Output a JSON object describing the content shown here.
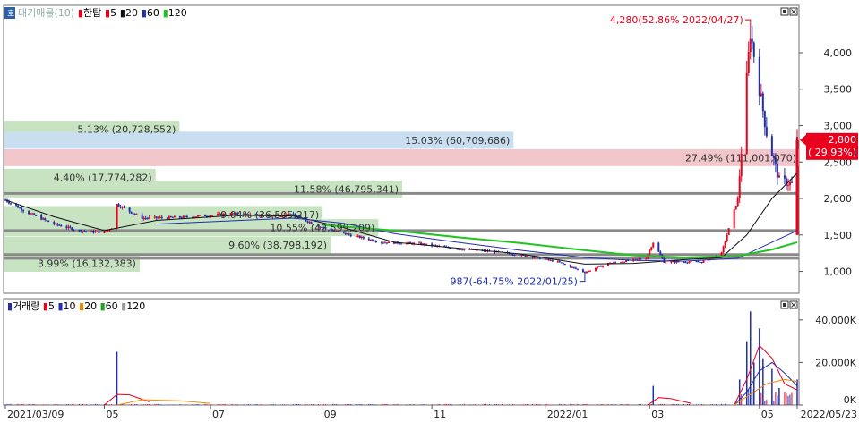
{
  "legend_price": {
    "items": [
      {
        "label": "대기매물(10)",
        "color": "#9bb9b0"
      },
      {
        "label": "한탑",
        "color": "#e8001c"
      },
      {
        "label": "5",
        "color": "#e8001c"
      },
      {
        "label": "20",
        "color": "#111111"
      },
      {
        "label": "60",
        "color": "#1f2fb0"
      },
      {
        "label": "120",
        "color": "#22c422"
      }
    ]
  },
  "legend_volume": {
    "items": [
      {
        "label": "거래량",
        "color": "#1f2fb0"
      },
      {
        "label": "5",
        "color": "#e8001c"
      },
      {
        "label": "10",
        "color": "#1f2fb0"
      },
      {
        "label": "20",
        "color": "#f08c00"
      },
      {
        "label": "60",
        "color": "#22a022"
      },
      {
        "label": "120",
        "color": "#999999"
      }
    ]
  },
  "controls": {
    "corner_label": "호"
  },
  "chart_data": [
    {
      "type": "candlestick",
      "ylim": [
        700,
        4650
      ],
      "yticks": [
        1000,
        1500,
        2000,
        2500,
        3000,
        3500,
        4000
      ],
      "ytick_labels": [
        "1,000",
        "1,500",
        "2,000",
        "2,500",
        "3,000",
        "3,500",
        "4,000"
      ],
      "x_labels": [
        {
          "date": "2021-03-09",
          "label": "2021/03/09"
        },
        {
          "date": "2021-05-03",
          "label": "05"
        },
        {
          "date": "2021-07-01",
          "label": "07"
        },
        {
          "date": "2021-09-01",
          "label": "09"
        },
        {
          "date": "2021-11-01",
          "label": "11"
        },
        {
          "date": "2022-01-03",
          "label": "2022/01"
        },
        {
          "date": "2022-03-02",
          "label": "03"
        },
        {
          "date": "2022-05-02",
          "label": "05"
        },
        {
          "date": "2022-05-23",
          "label": "2022/05/23"
        }
      ],
      "price_path": [
        [
          "2021-03-09",
          1980
        ],
        [
          "2021-03-22",
          1800
        ],
        [
          "2021-04-05",
          1650
        ],
        [
          "2021-04-19",
          1560
        ],
        [
          "2021-05-03",
          1530
        ],
        [
          "2021-05-07",
          1600
        ],
        [
          "2021-05-10",
          1920
        ],
        [
          "2021-05-24",
          1730
        ],
        [
          "2021-06-14",
          1740
        ],
        [
          "2021-07-12",
          1790
        ],
        [
          "2021-08-02",
          1760
        ],
        [
          "2021-08-16",
          1780
        ],
        [
          "2021-08-30",
          1620
        ],
        [
          "2021-09-13",
          1520
        ],
        [
          "2021-10-04",
          1400
        ],
        [
          "2021-10-25",
          1380
        ],
        [
          "2021-11-15",
          1310
        ],
        [
          "2021-12-06",
          1270
        ],
        [
          "2021-12-27",
          1200
        ],
        [
          "2022-01-10",
          1130
        ],
        [
          "2022-01-25",
          987
        ],
        [
          "2022-02-07",
          1110
        ],
        [
          "2022-02-28",
          1180
        ],
        [
          "2022-03-04",
          1400
        ],
        [
          "2022-03-10",
          1130
        ],
        [
          "2022-03-31",
          1130
        ],
        [
          "2022-04-11",
          1250
        ],
        [
          "2022-04-20",
          2000
        ],
        [
          "2022-04-27",
          4280
        ],
        [
          "2022-05-06",
          2900
        ],
        [
          "2022-05-13",
          2250
        ],
        [
          "2022-05-20",
          2200
        ],
        [
          "2022-05-23",
          2800
        ]
      ],
      "series": [
        {
          "name": "20",
          "color": "#111111",
          "points": [
            [
              "2021-03-09",
              1980
            ],
            [
              "2021-04-05",
              1750
            ],
            [
              "2021-05-03",
              1560
            ],
            [
              "2021-06-01",
              1700
            ],
            [
              "2021-07-15",
              1770
            ],
            [
              "2021-08-16",
              1760
            ],
            [
              "2021-09-13",
              1600
            ],
            [
              "2021-10-11",
              1400
            ],
            [
              "2021-11-15",
              1320
            ],
            [
              "2021-12-20",
              1240
            ],
            [
              "2022-01-25",
              1100
            ],
            [
              "2022-02-21",
              1110
            ],
            [
              "2022-03-21",
              1160
            ],
            [
              "2022-04-11",
              1190
            ],
            [
              "2022-04-25",
              1500
            ],
            [
              "2022-05-09",
              2000
            ],
            [
              "2022-05-23",
              2350
            ]
          ]
        },
        {
          "name": "60",
          "color": "#1f2fb0",
          "points": [
            [
              "2021-06-01",
              1650
            ],
            [
              "2021-08-16",
              1730
            ],
            [
              "2021-09-13",
              1660
            ],
            [
              "2021-10-11",
              1520
            ],
            [
              "2021-11-15",
              1400
            ],
            [
              "2021-12-20",
              1290
            ],
            [
              "2022-01-25",
              1190
            ],
            [
              "2022-02-21",
              1150
            ],
            [
              "2022-03-21",
              1140
            ],
            [
              "2022-04-20",
              1180
            ],
            [
              "2022-05-09",
              1400
            ],
            [
              "2022-05-23",
              1560
            ]
          ]
        },
        {
          "name": "120",
          "color": "#22c422",
          "points": [
            [
              "2021-09-01",
              1640
            ],
            [
              "2021-10-11",
              1560
            ],
            [
              "2021-11-15",
              1470
            ],
            [
              "2021-12-20",
              1390
            ],
            [
              "2022-01-25",
              1290
            ],
            [
              "2022-02-21",
              1220
            ],
            [
              "2022-03-21",
              1190
            ],
            [
              "2022-04-20",
              1210
            ],
            [
              "2022-05-09",
              1300
            ],
            [
              "2022-05-23",
              1400
            ]
          ]
        }
      ],
      "supply_zones": [
        {
          "label": "5.13% (20,728,552)",
          "price": 2950,
          "fraction": 0.22,
          "color": "#c7e3c2"
        },
        {
          "label": "15.03% (60,709,686)",
          "price": 2800,
          "fraction": 0.64,
          "color": "#c9dff0"
        },
        {
          "label": "27.49% (111,001,070)",
          "price": 2560,
          "fraction": 1.0,
          "color": "#f2c7cb"
        },
        {
          "label": "4.40% (17,774,282)",
          "price": 2290,
          "fraction": 0.19,
          "color": "#c7e3c2"
        },
        {
          "label": "11.58% (46,795,341)",
          "price": 2130,
          "fraction": 0.5,
          "color": "#c7e3c2"
        },
        {
          "label": "9.04% (36,505,217)",
          "price": 1780,
          "fraction": 0.4,
          "color": "#c7e3c2"
        },
        {
          "label": "10.55% (42,599,209)",
          "price": 1600,
          "fraction": 0.47,
          "color": "#c7e3c2"
        },
        {
          "label": "9.60% (38,798,192)",
          "price": 1360,
          "fraction": 0.41,
          "color": "#c7e3c2"
        },
        {
          "label": "3.99% (16,132,383)",
          "price": 1110,
          "fraction": 0.17,
          "color": "#c7e3c2"
        }
      ],
      "horizontal_lines": [
        2070,
        1560,
        1230,
        1180
      ],
      "annotations": [
        {
          "text": "4,280(52.86% 2022/04/27)",
          "date": "2022-04-27",
          "price": 4280,
          "color": "#e8001c"
        },
        {
          "text": "987(-64.75% 2022/01/25)",
          "date": "2022-01-25",
          "price": 987,
          "color": "#1f2fb0"
        }
      ],
      "current_price": {
        "value": 2800,
        "label": "2,800",
        "change": "( 29.93%)",
        "color": "#e8001c"
      }
    },
    {
      "type": "bar",
      "ylim": [
        0,
        50000
      ],
      "yticks": [
        0,
        20000,
        40000
      ],
      "ytick_labels": [
        "0K",
        "20,000K",
        "40,000K"
      ],
      "spikes": [
        [
          "2021-05-10",
          25000
        ],
        [
          "2022-03-04",
          9000
        ],
        [
          "2022-04-21",
          12000
        ],
        [
          "2022-04-25",
          30000
        ],
        [
          "2022-04-27",
          44000
        ],
        [
          "2022-04-29",
          20000
        ],
        [
          "2022-05-02",
          36000
        ],
        [
          "2022-05-04",
          22000
        ],
        [
          "2022-05-09",
          17000
        ],
        [
          "2022-05-13",
          8000
        ],
        [
          "2022-05-23",
          12000
        ]
      ]
    }
  ]
}
